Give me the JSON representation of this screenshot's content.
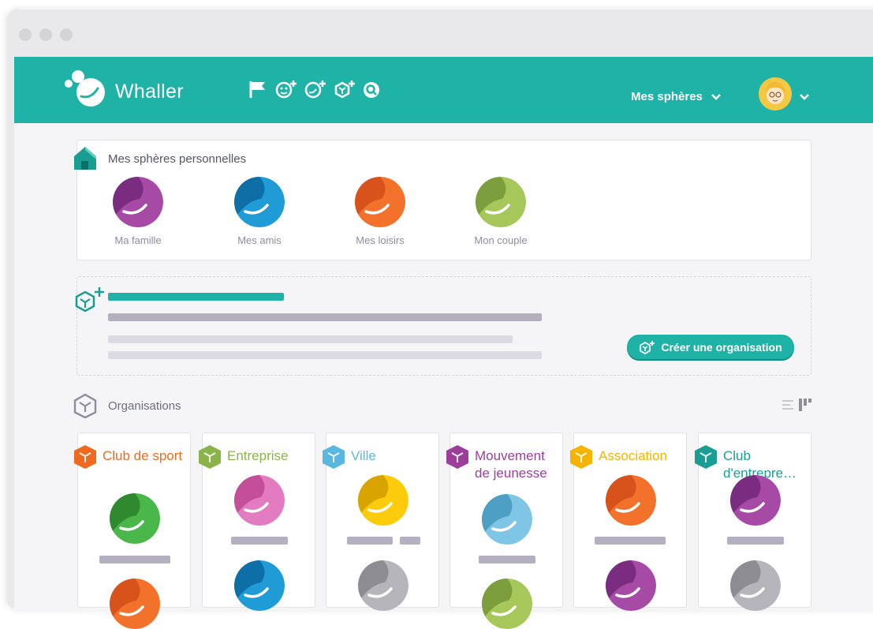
{
  "app": {
    "brand": "Whaller"
  },
  "header": {
    "spheres_menu_label": "Mes sphères",
    "tool_icons": [
      "flag-icon",
      "add-user-icon",
      "add-sphere-icon",
      "add-organisation-icon",
      "search-icon"
    ],
    "accent_color": "#1fb2a6"
  },
  "personal": {
    "title": "Mes sphères personnelles",
    "spheres": [
      {
        "label": "Ma famille",
        "color_dark": "#7a2d80",
        "color_light": "#a64aa6"
      },
      {
        "label": "Mes amis",
        "color_dark": "#0d6fa6",
        "color_light": "#1f9bd6"
      },
      {
        "label": "Mes loisirs",
        "color_dark": "#d8521c",
        "color_light": "#f2712b"
      },
      {
        "label": "Mon couple",
        "color_dark": "#7d9e3c",
        "color_light": "#a6c85a"
      }
    ]
  },
  "create_org": {
    "button_label": "Créer une organisation"
  },
  "organisations": {
    "title": "Organisations",
    "items": [
      {
        "title": "Club de sport",
        "color": "#ee6a20"
      },
      {
        "title": "Entreprise",
        "color": "#8ab34a"
      },
      {
        "title": "Ville",
        "color": "#5ab8e0"
      },
      {
        "title": "Mouvement de jeunesse",
        "color": "#9b3f9b"
      },
      {
        "title": "Association",
        "color": "#f4b400"
      },
      {
        "title": "Club d'entrepre…",
        "color": "#1a9e93"
      }
    ]
  }
}
